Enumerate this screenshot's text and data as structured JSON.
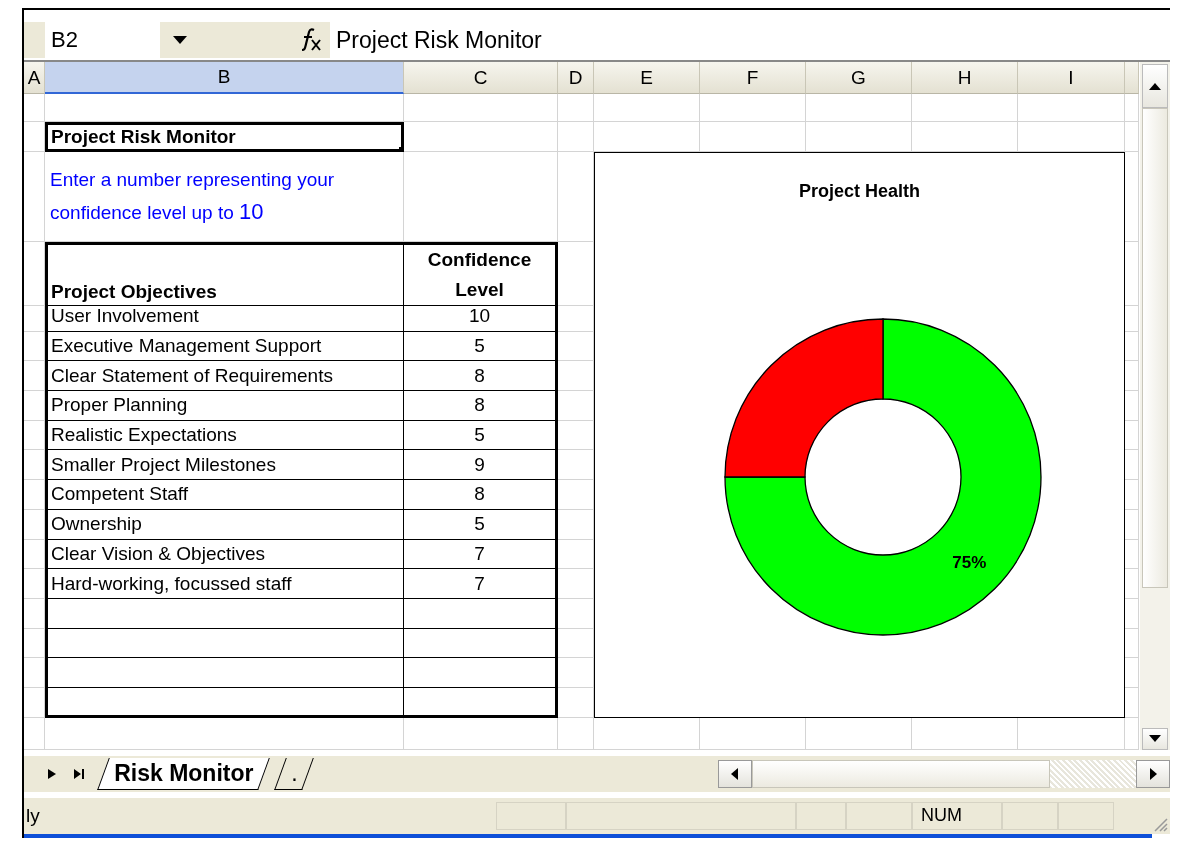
{
  "name_box": "B2",
  "formula": "Project Risk Monitor",
  "columns": [
    {
      "label": "A",
      "selected": false
    },
    {
      "label": "B",
      "selected": true
    },
    {
      "label": "C",
      "selected": false
    },
    {
      "label": "D",
      "selected": false
    },
    {
      "label": "E",
      "selected": false
    },
    {
      "label": "F",
      "selected": false
    },
    {
      "label": "G",
      "selected": false
    },
    {
      "label": "H",
      "selected": false
    },
    {
      "label": "I",
      "selected": false
    }
  ],
  "sheet_title": "Project Risk Monitor",
  "instruction": "Enter a number representing your confidence level up to",
  "instruction_max": "10",
  "table": {
    "columns": [
      "Project Objectives",
      "Confidence Level"
    ],
    "rows": [
      [
        "User Involvement",
        "10"
      ],
      [
        "Executive Management Support",
        "5"
      ],
      [
        "Clear Statement of Requirements",
        "8"
      ],
      [
        "Proper Planning",
        "8"
      ],
      [
        "Realistic Expectations",
        "5"
      ],
      [
        "Smaller Project Milestones",
        "9"
      ],
      [
        "Competent Staff",
        "8"
      ],
      [
        "Ownership",
        "5"
      ],
      [
        "Clear Vision & Objectives",
        "7"
      ],
      [
        "Hard-working, focussed staff",
        "7"
      ]
    ]
  },
  "chart": {
    "chart_data": {
      "type": "donut",
      "title": "Project Health",
      "values": [
        75,
        25
      ],
      "colors": [
        "#00ff00",
        "#ff0000"
      ],
      "value_labels": [
        "75%",
        null
      ]
    }
  },
  "sheet_tabs": [
    {
      "label": "Risk Monitor",
      "selected": true
    },
    {
      "label": ".",
      "selected": false
    }
  ],
  "status": {
    "text": "ly",
    "indicator": "NUM"
  }
}
